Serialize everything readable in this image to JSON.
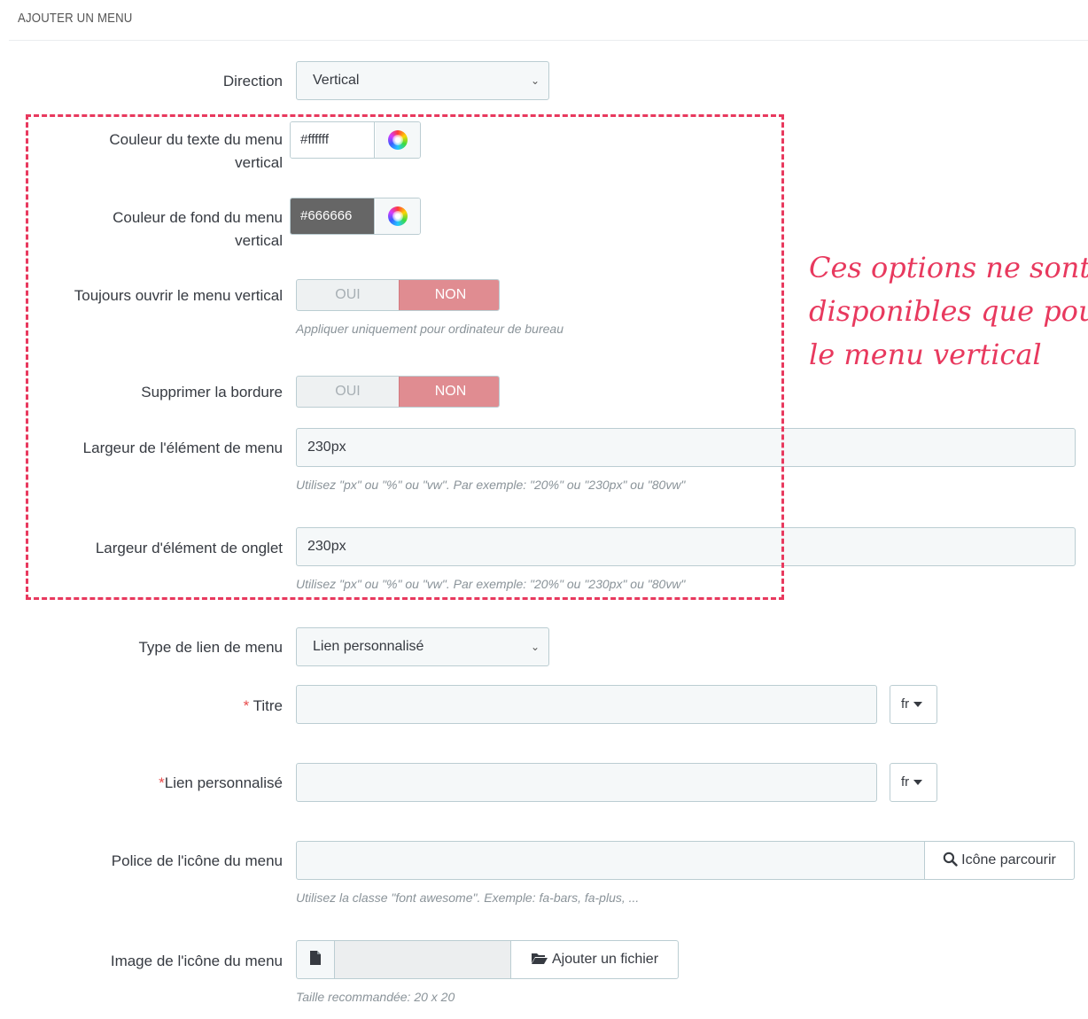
{
  "panel": {
    "title": "AJOUTER UN MENU"
  },
  "direction": {
    "label": "Direction",
    "value": "Vertical"
  },
  "text_color": {
    "label_line1": "Couleur du texte du menu",
    "label_line2": "vertical",
    "value": "#ffffff",
    "swatch": "#ffffff"
  },
  "bg_color": {
    "label_line1": "Couleur de fond du menu",
    "label_line2": "vertical",
    "value": "#666666",
    "swatch": "#666666"
  },
  "always_open": {
    "label": "Toujours ouvrir le menu vertical",
    "on_label": "OUI",
    "off_label": "NON",
    "selected": "NON",
    "help": "Appliquer uniquement pour ordinateur de bureau"
  },
  "remove_border": {
    "label": "Supprimer la bordure",
    "on_label": "OUI",
    "off_label": "NON",
    "selected": "NON"
  },
  "menu_item_width": {
    "label": "Largeur de l'élément de menu",
    "value": "230px",
    "help": "Utilisez \"px\" ou \"%\" ou \"vw\". Par exemple: \"20%\" ou \"230px\" ou \"80vw\""
  },
  "tab_item_width": {
    "label": "Largeur d'élément de onglet",
    "value": "230px",
    "help": "Utilisez \"px\" ou \"%\" ou \"vw\". Par exemple: \"20%\" ou \"230px\" ou \"80vw\""
  },
  "link_type": {
    "label": "Type de lien de menu",
    "value": "Lien personnalisé"
  },
  "title_field": {
    "required_mark": "*",
    "label": " Titre",
    "value": "",
    "lang": "fr"
  },
  "custom_link": {
    "required_mark": "*",
    "label": "Lien personnalisé",
    "value": "",
    "lang": "fr"
  },
  "icon_font": {
    "label": "Police de l'icône du menu",
    "value": "",
    "button_label": "Icône parcourir",
    "help": "Utilisez la classe \"font awesome\". Exemple: fa-bars, fa-plus, ..."
  },
  "icon_image": {
    "label": "Image de l'icône du menu",
    "button_label": "Ajouter un fichier",
    "help": "Taille recommandée: 20 x 20"
  },
  "annotation": {
    "line1": "Ces options ne sont",
    "line2": "disponibles que pour",
    "line3": "le menu vertical"
  },
  "colors": {
    "accent_red": "#e8395e",
    "switch_active": "#e08c91",
    "input_bg": "#f5f8f9",
    "border": "#bbcdd2"
  },
  "icons": [
    "chevron-down-icon",
    "color-wheel-icon",
    "caret-down-icon",
    "search-icon",
    "file-icon",
    "folder-open-icon"
  ]
}
